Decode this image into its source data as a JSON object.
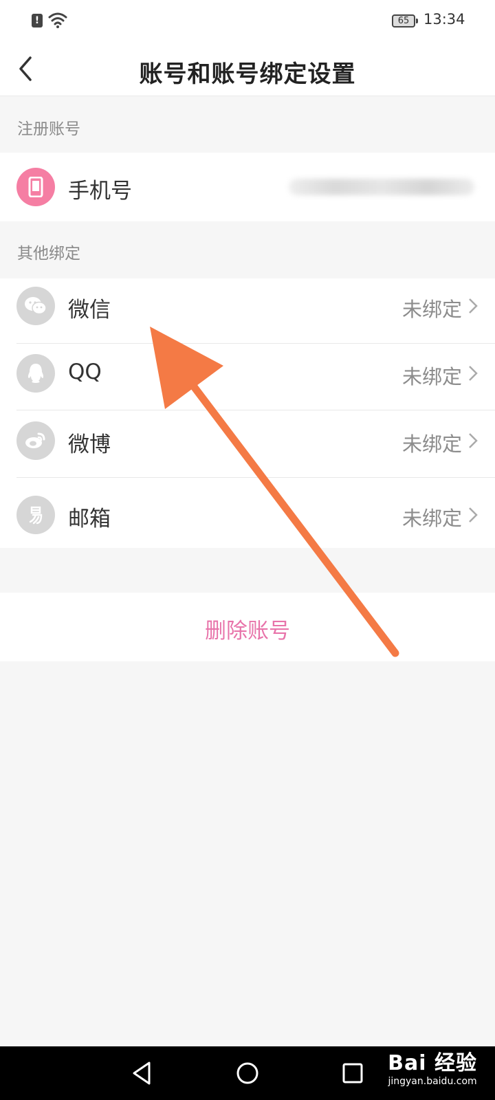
{
  "status_bar": {
    "time": "13:34",
    "battery": "65",
    "icons": [
      "alert-icon",
      "wifi-icon",
      "battery-icon"
    ]
  },
  "header": {
    "title": "账号和账号绑定设置",
    "back_icon": "chevron-left-icon"
  },
  "registered_section": {
    "header": "注册账号",
    "item": {
      "label": "手机号",
      "icon": "phone-icon",
      "icon_color": "#f57ea3"
    }
  },
  "other_section": {
    "header": "其他绑定",
    "items": [
      {
        "label": "微信",
        "status": "未绑定",
        "icon": "wechat-icon"
      },
      {
        "label": "QQ",
        "status": "未绑定",
        "icon": "qq-icon"
      },
      {
        "label": "微博",
        "status": "未绑定",
        "icon": "weibo-icon"
      },
      {
        "label": "邮箱",
        "status": "未绑定",
        "icon": "netease-mail-icon"
      }
    ]
  },
  "delete_account": {
    "label": "删除账号",
    "color": "#e874aa"
  },
  "annotation": {
    "arrow_color": "#f47a45"
  },
  "system_nav": {
    "buttons": [
      "back-triangle-icon",
      "home-circle-icon",
      "recents-square-icon"
    ]
  },
  "watermark": {
    "main": "Bai 经验",
    "sub": "jingyan.baidu.com"
  }
}
